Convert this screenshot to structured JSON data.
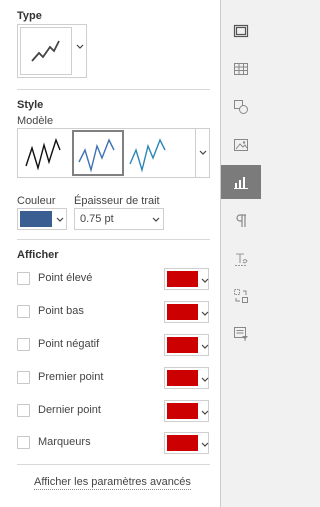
{
  "type_section": {
    "title": "Type"
  },
  "style_section": {
    "title": "Style",
    "model_label": "Modèle",
    "color_label": "Couleur",
    "line_width_label": "Épaisseur de trait",
    "line_width_value": "0.75 pt",
    "line_color": "#3a5d92"
  },
  "show_section": {
    "title": "Afficher",
    "items": [
      {
        "label": "Point élevé",
        "checked": false,
        "color": "#cc0000"
      },
      {
        "label": "Point bas",
        "checked": false,
        "color": "#cc0000"
      },
      {
        "label": "Point négatif",
        "checked": false,
        "color": "#cc0000"
      },
      {
        "label": "Premier point",
        "checked": false,
        "color": "#cc0000"
      },
      {
        "label": "Dernier point",
        "checked": false,
        "color": "#cc0000"
      },
      {
        "label": "Marqueurs",
        "checked": false,
        "color": "#cc0000"
      }
    ]
  },
  "advanced_link": "Afficher les paramètres avancés",
  "sidebar": {
    "items": [
      {
        "icon": "table-settings-icon",
        "active": false
      },
      {
        "icon": "spreadsheet-icon",
        "active": false
      },
      {
        "icon": "shape-icon",
        "active": false
      },
      {
        "icon": "image-icon",
        "active": false
      },
      {
        "icon": "chart-icon",
        "active": true
      },
      {
        "icon": "paragraph-icon",
        "active": false
      },
      {
        "icon": "text-art-icon",
        "active": false
      },
      {
        "icon": "pivot-table-icon",
        "active": false
      },
      {
        "icon": "slicer-icon",
        "active": false
      }
    ]
  }
}
